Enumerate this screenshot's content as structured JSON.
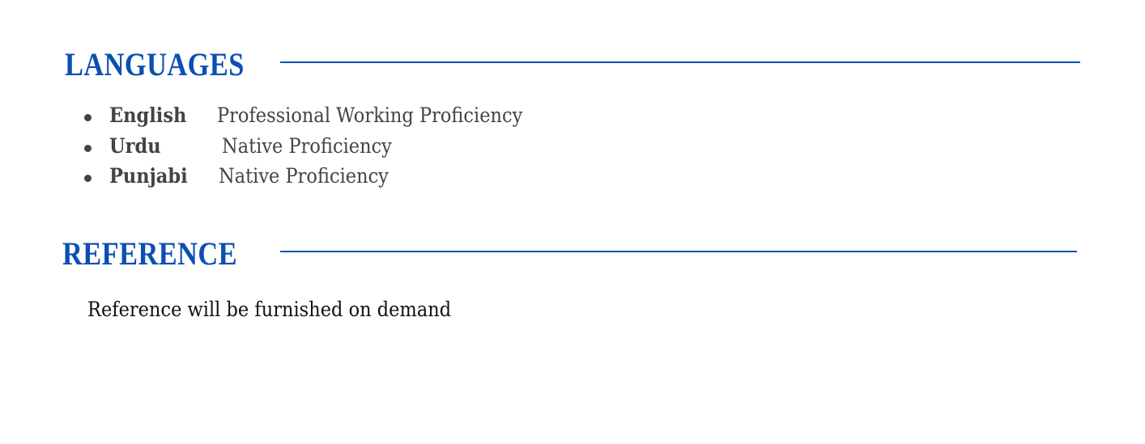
{
  "languages": {
    "title": "LANGUAGES",
    "items": [
      {
        "name": "English",
        "level": "Professional Working Proficiency"
      },
      {
        "name": "Urdu",
        "level": "Native Proficiency"
      },
      {
        "name": "Punjabi",
        "level": "Native Proficiency"
      }
    ]
  },
  "reference": {
    "title": "REFERENCE",
    "text": "Reference will be furnished on demand"
  },
  "colors": {
    "accent": "#0b4fb3",
    "text": "#444444"
  }
}
